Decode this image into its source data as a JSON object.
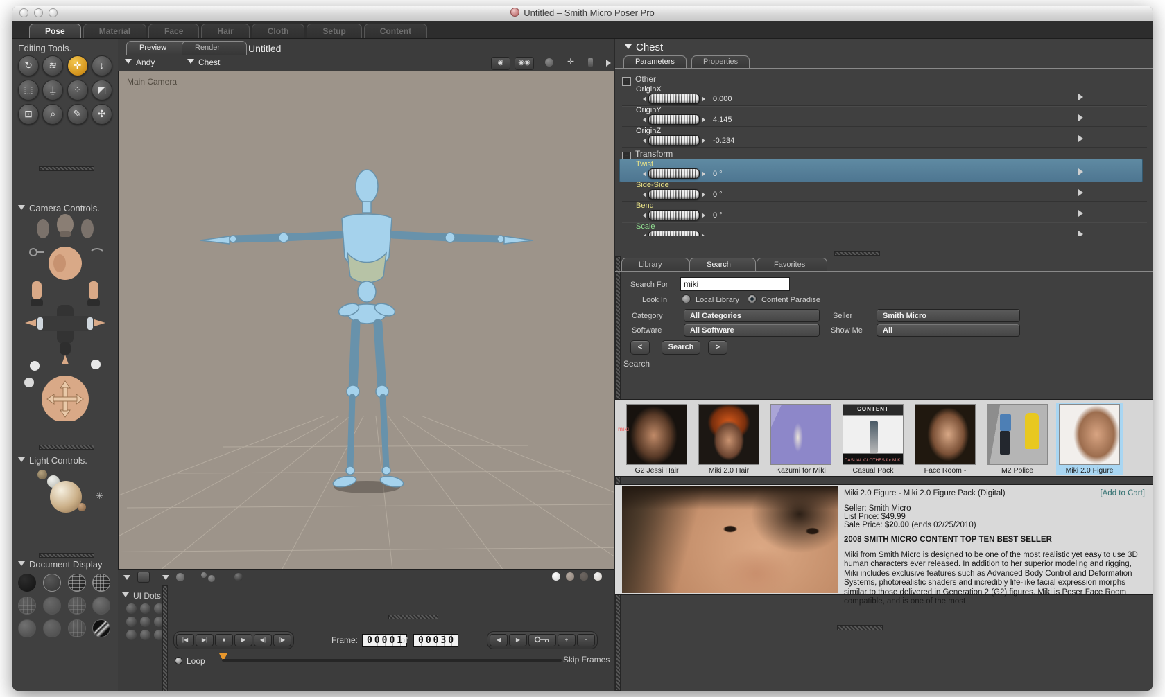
{
  "window": {
    "title": "Untitled – Smith Micro Poser Pro"
  },
  "room_tabs": [
    {
      "label": "Pose"
    },
    {
      "label": "Material"
    },
    {
      "label": "Face"
    },
    {
      "label": "Hair"
    },
    {
      "label": "Cloth"
    },
    {
      "label": "Setup"
    },
    {
      "label": "Content"
    }
  ],
  "sidebar": {
    "editing_tools_heading": "Editing Tools.",
    "camera_controls_heading": "Camera Controls.",
    "light_controls_heading": "Light Controls.",
    "document_display_heading": "Document Display"
  },
  "document": {
    "tab_preview": "Preview",
    "tab_render": "Render",
    "title": "Untitled",
    "figure_menu": "Andy",
    "actor_menu": "Chest",
    "camera_label": "Main Camera"
  },
  "playback": {
    "ui_dots_heading": "UI Dots.",
    "frame_label": "Frame:",
    "current_frame": "00001",
    "of_label": "of",
    "total_frames": "00030",
    "loop_label": "Loop",
    "skip_frames_label": "Skip Frames"
  },
  "parameters": {
    "actor": "Chest",
    "tab_parameters": "Parameters",
    "tab_properties": "Properties",
    "group_other": "Other",
    "group_transform": "Transform",
    "rows": [
      {
        "label": "OriginX",
        "value": "0.000"
      },
      {
        "label": "OriginY",
        "value": "4.145"
      },
      {
        "label": "OriginZ",
        "value": "-0.234"
      },
      {
        "label": "Twist",
        "value": "0 °"
      },
      {
        "label": "Side-Side",
        "value": "0 °"
      },
      {
        "label": "Bend",
        "value": "0 °"
      },
      {
        "label": "Scale",
        "value": ""
      }
    ]
  },
  "library": {
    "tab_library": "Library",
    "tab_search": "Search",
    "tab_favorites": "Favorites",
    "form": {
      "search_for_label": "Search For",
      "search_value": "miki",
      "look_in_label": "Look In",
      "local_library_label": "Local Library",
      "content_paradise_label": "Content Paradise",
      "category_label": "Category",
      "category_value": "All Categories",
      "seller_label": "Seller",
      "seller_value": "Smith Micro",
      "software_label": "Software",
      "software_value": "All Software",
      "show_me_label": "Show Me",
      "show_me_value": "All",
      "prev_label": "<",
      "search_label": "Search",
      "next_label": ">"
    },
    "results_heading": "Search",
    "results": [
      {
        "label": "G2 Jessi Hair"
      },
      {
        "label": "Miki 2.0 Hair"
      },
      {
        "label": "Kazumi for Miki"
      },
      {
        "label": "Casual Pack"
      },
      {
        "label": "Face Room -"
      },
      {
        "label": "M2 Police"
      },
      {
        "label": "Miki 2.0 Figure"
      }
    ],
    "casual_pack_banner_top": "CONTENT",
    "casual_pack_banner_bottom": "CASUAL CLOTHES for MIKI",
    "detail": {
      "title": "Miki 2.0 Figure - Miki 2.0 Figure Pack (Digital)",
      "add_to_cart_label": "[Add to Cart]",
      "seller_line": "Seller: Smith Micro",
      "list_price_line": "List Price: $49.99",
      "sale_price_prefix": "Sale Price:",
      "sale_price": "$20.00",
      "sale_ends": "(ends 02/25/2010)",
      "banner": "2008 SMITH MICRO CONTENT TOP TEN BEST SELLER",
      "description": "Miki from Smith Micro is designed to be one of the most realistic yet easy to use 3D human characters ever released. In addition to her superior modeling and rigging, Miki includes exclusive features such as Advanced Body Control and Deformation Systems, photorealistic shaders and incredibly life-like facial expression morphs similar to those delivered in Generation 2 (G2) figures. Miki is Poser Face Room compatible, and is one of the most"
    }
  },
  "colors": {
    "accent_orange": "#e8a33d",
    "highlight_row": "#5a8096",
    "label_yellow": "#e9e388",
    "label_green": "#93e093",
    "selected_thumb": "#a9d6f2",
    "add_to_cart": "#2e6e6e",
    "viewport_bg": "#9d948a",
    "figure_blue": "#a5d2ec"
  }
}
